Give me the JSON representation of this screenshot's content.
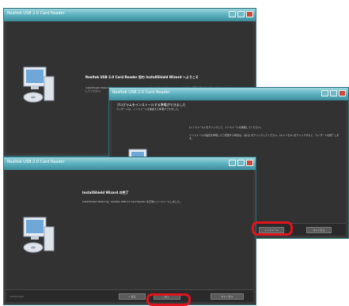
{
  "windows": {
    "welcome": {
      "title": "Realtek USB 2.0 Card Reader",
      "heading": "Realtek USB 2.0 Card Reader 用の InstallShield Wizard へようこそ",
      "body": "InstallShield Wizard は、Realtek USB 2.0 Card Reader をコンピュータにインストールします。続行するには、[次へ] をクリックしてください。"
    },
    "ready": {
      "title": "Realtek USB 2.0 Card Reader",
      "header_title": "プログラムをインストールする準備ができました",
      "header_sub": "ウィザードは、インストールを開始する準備ができました。",
      "line1": "[インストール] をクリックして、インストールを開始してください。",
      "line2": "インストールの設定を参照したり変更する場合は、[戻る] をクリックしてください。[キャンセル] をクリックすると、ウィザードを終了します。",
      "install_button": "インストール",
      "cancel_button": "キャンセル"
    },
    "finish": {
      "title": "Realtek USB 2.0 Card Reader",
      "heading": "InstallShield Wizard の完了",
      "body": "InstallShield Wizard は、Realtek USB 2.0 Card Reader を正常にインストールしました。",
      "back_button": "< 戻る",
      "finish_button": "完了",
      "cancel_button": "キャンセル",
      "footer_label": "InstallShield"
    }
  },
  "colors": {
    "highlight": "#e0141e",
    "window_bg": "#323232",
    "titlebar": "#5fb3c1"
  }
}
